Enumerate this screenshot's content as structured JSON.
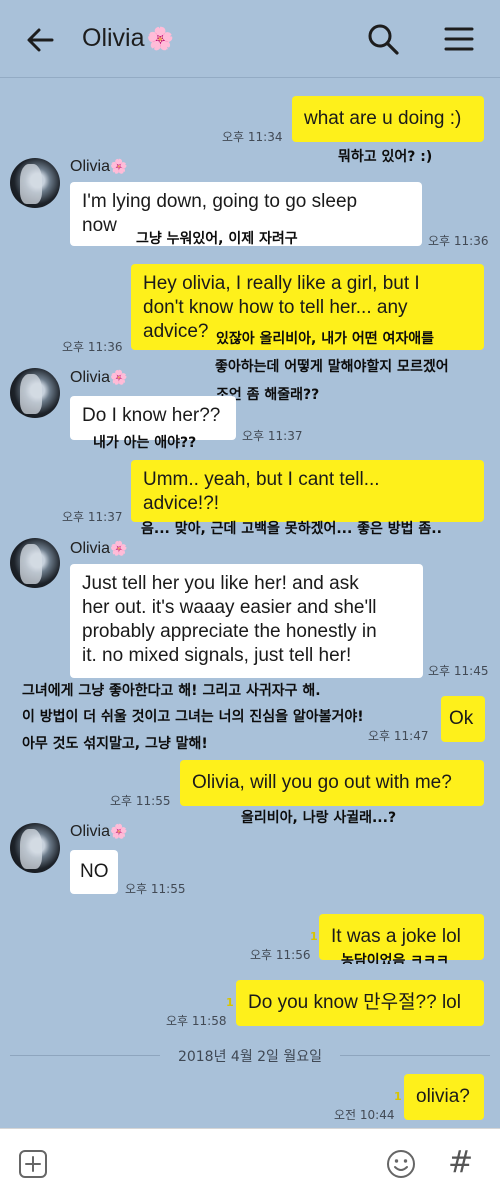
{
  "header": {
    "title": "Olivia",
    "title_flower": "🌸",
    "icons": [
      "back-arrow-icon",
      "search-icon",
      "menu-icon"
    ]
  },
  "messages": [
    {
      "side": "me",
      "text": "what are u doing :)",
      "time": "오후 11:34",
      "sub": "뭐하고 있어? :)"
    },
    {
      "side": "them",
      "sender": "Olivia",
      "text_lines": [
        "I'm lying down, going to go sleep",
        "now"
      ],
      "time": "오후 11:36",
      "sub": "그냥 누워있어, 이제 자려구"
    },
    {
      "side": "me",
      "text_lines": [
        "Hey olivia, I really like a girl, but I",
        "don't know how to tell her... any",
        "advice?"
      ],
      "time": "오후 11:36",
      "sub_lines": [
        "있잖아 올리비아, 내가 어떤 여자애를",
        "좋아하는데 어떻게 말해야할지 모르겠어",
        "조언 좀 해줄래??"
      ]
    },
    {
      "side": "them",
      "sender": "Olivia",
      "text": "Do I know her??",
      "time": "오후 11:37",
      "sub": "내가 아는 애야??"
    },
    {
      "side": "me",
      "text_lines": [
        "Umm.. yeah, but I cant tell...",
        "advice!?!"
      ],
      "time": "오후 11:37",
      "sub": "음... 맞아, 근데 고백을 못하겠어... 좋은 방법 좀.."
    },
    {
      "side": "them",
      "sender": "Olivia",
      "text_lines": [
        "Just tell her you like her! and ask",
        "her out. it's waaay easier and she'll",
        "probably appreciate the honestly in",
        "it. no mixed signals, just tell her!"
      ],
      "time": "오후 11:45",
      "sub_lines": [
        "그녀에게 그냥 좋아한다고 해! 그리고 사귀자구 해.",
        "이 방법이 더 쉬울 것이고 그녀는 너의 진심을 알아볼거야!",
        "아무 것도 섞지말고, 그냥 말해!"
      ]
    },
    {
      "side": "me",
      "text": "Ok",
      "time": "오후 11:47"
    },
    {
      "side": "me",
      "text": "Olivia, will you go out with me?",
      "time": "오후 11:55",
      "sub": "올리비아, 나랑 사귈래...?"
    },
    {
      "side": "them",
      "sender": "Olivia",
      "text": "NO",
      "time": "오후 11:55"
    },
    {
      "side": "me",
      "text": "It was a joke lol",
      "time": "오후 11:56",
      "unread": "1",
      "sub": "농담이었음 ㅋㅋㅋ"
    },
    {
      "side": "me",
      "text": "Do you know 만우절?? lol",
      "time": "오후 11:58",
      "unread": "1"
    },
    {
      "side": "me",
      "text": "olivia?",
      "time": "오전 10:44",
      "unread": "1"
    }
  ],
  "date_divider": "2018년 4월 2일 월요일",
  "bottom_bar": {
    "icons": [
      "plus-icon",
      "emoji-icon",
      "hash-icon"
    ],
    "hash_glyph": "#"
  },
  "colors": {
    "background": "#a9c1d9",
    "my_bubble": "#fef01b",
    "their_bubble": "#ffffff"
  }
}
